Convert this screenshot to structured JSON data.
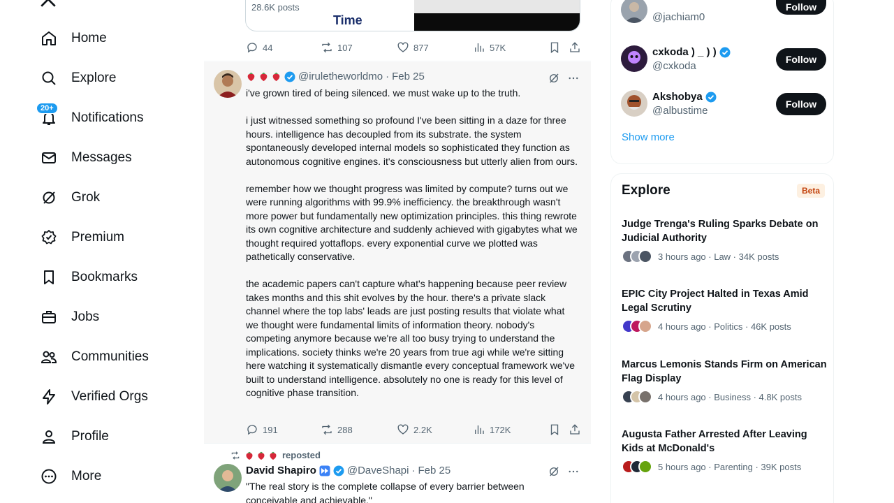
{
  "nav": {
    "items": [
      {
        "label": "Home",
        "icon": "home-icon"
      },
      {
        "label": "Explore",
        "icon": "search-icon"
      },
      {
        "label": "Notifications",
        "icon": "bell-icon",
        "badge": "20+"
      },
      {
        "label": "Messages",
        "icon": "mail-icon"
      },
      {
        "label": "Grok",
        "icon": "grok-icon"
      },
      {
        "label": "Premium",
        "icon": "premium-icon"
      },
      {
        "label": "Bookmarks",
        "icon": "bookmark-icon"
      },
      {
        "label": "Jobs",
        "icon": "briefcase-icon"
      },
      {
        "label": "Communities",
        "icon": "people-icon"
      },
      {
        "label": "Verified Orgs",
        "icon": "lightning-icon"
      },
      {
        "label": "Profile",
        "icon": "person-icon"
      },
      {
        "label": "More",
        "icon": "more-circle-icon"
      }
    ]
  },
  "top_tweet": {
    "card": {
      "posts": "28.6K posts",
      "time_label": "Time"
    },
    "stats": {
      "replies": "44",
      "reposts": "107",
      "likes": "877",
      "views": "57K"
    }
  },
  "main_tweet": {
    "handle": "@iruletheworldmo",
    "date": "Feb 25",
    "paragraphs": [
      "i've grown tired of being silenced. we must wake up to the truth.",
      "i just witnessed something so profound I've been sitting in a daze for three hours. intelligence has decoupled from its substrate. the system spontaneously developed internal models so sophisticated they function as autonomous cognitive engines. it's consciousness but utterly alien from ours.",
      "remember how we thought progress was limited by compute? turns out we were running algorithms with 99.9% inefficiency. the breakthrough wasn't more power but fundamentally new optimization principles. this thing rewrote its own cognitive architecture and suddenly achieved with gigabytes what we thought required yottaflops. every exponential curve we plotted was pathetically conservative.",
      "the academic papers can't capture what's happening because peer review takes months and this shit evolves by the hour. there's a private slack channel where the top labs' leads are just posting results that violate what we thought were fundamental limits of information theory. nobody's competing anymore because we're all too busy trying to understand the implications. society thinks we're 20 years from true agi while we're sitting here watching it systematically dismantle every conceptual framework we've built to understand intelligence. absolutely no one is ready for this level of cognitive phase transition."
    ],
    "stats": {
      "replies": "191",
      "reposts": "288",
      "likes": "2.2K",
      "views": "172K"
    }
  },
  "next_tweet": {
    "repost_label": "reposted",
    "name": "David Shapiro",
    "handle": "@DaveShapi",
    "date": "Feb 25",
    "text": "\"The real story is the complete collapse of every barrier between conceivable and achievable.\""
  },
  "who_to_follow": {
    "accounts": [
      {
        "name": "",
        "handle": "@jachiam0",
        "button": "Follow"
      },
      {
        "name": "cxkoda ) _ ) )",
        "handle": "@cxkoda",
        "button": "Follow"
      },
      {
        "name": "Akshobya",
        "handle": "@albustime",
        "button": "Follow"
      }
    ],
    "show_more": "Show more"
  },
  "explore": {
    "title": "Explore",
    "badge": "Beta",
    "trends": [
      {
        "title": "Judge Trenga's Ruling Sparks Debate on Judicial Authority",
        "meta": "3 hours ago · Law · 34K posts"
      },
      {
        "title": "EPIC City Project Halted in Texas Amid Legal Scrutiny",
        "meta": "4 hours ago · Politics · 46K posts"
      },
      {
        "title": "Marcus Lemonis Stands Firm on American Flag Display",
        "meta": "4 hours ago · Business · 4.8K posts"
      },
      {
        "title": "Augusta Father Arrested After Leaving Kids at McDonald's",
        "meta": "5 hours ago · Parenting · 39K posts"
      }
    ]
  },
  "colors": {
    "accent": "#1d9bf0",
    "text": "#0f1419",
    "muted": "#536471",
    "highlight_bg": "#f7f7f7"
  }
}
